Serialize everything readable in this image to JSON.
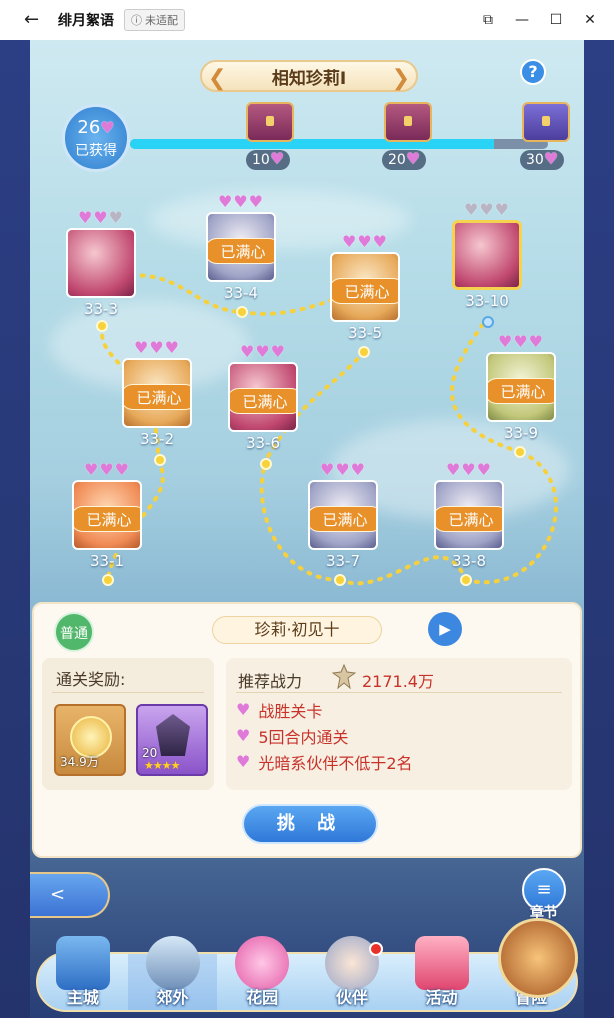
{
  "window": {
    "title": "绯月絮语",
    "badge": "未适配",
    "back_icon": "←",
    "minimize": "—",
    "maximize": "☐",
    "close": "✕",
    "pin": "⧉"
  },
  "header": {
    "chapter_title": "相知珍莉Ⅰ",
    "prev_icon": "chevron-left-icon",
    "next_icon": "chevron-right-icon",
    "help": "?"
  },
  "progress": {
    "earned_count": "26",
    "earned_label": "已获得",
    "fill_fraction": 0.87,
    "tiers": [
      {
        "value": "10"
      },
      {
        "value": "20"
      },
      {
        "value": "30"
      }
    ]
  },
  "stages": [
    {
      "id": "33-1",
      "label": "33-1",
      "status": "已满心",
      "hearts": 3,
      "max": 3
    },
    {
      "id": "33-2",
      "label": "33-2",
      "status": "已满心",
      "hearts": 3,
      "max": 3
    },
    {
      "id": "33-3",
      "label": "33-3",
      "status": "",
      "hearts": 2,
      "max": 3
    },
    {
      "id": "33-4",
      "label": "33-4",
      "status": "已满心",
      "hearts": 3,
      "max": 3
    },
    {
      "id": "33-5",
      "label": "33-5",
      "status": "已满心",
      "hearts": 3,
      "max": 3
    },
    {
      "id": "33-6",
      "label": "33-6",
      "status": "已满心",
      "hearts": 3,
      "max": 3
    },
    {
      "id": "33-7",
      "label": "33-7",
      "status": "已满心",
      "hearts": 3,
      "max": 3
    },
    {
      "id": "33-8",
      "label": "33-8",
      "status": "已满心",
      "hearts": 3,
      "max": 3
    },
    {
      "id": "33-9",
      "label": "33-9",
      "status": "已满心",
      "hearts": 3,
      "max": 3
    },
    {
      "id": "33-10",
      "label": "33-10",
      "status": "",
      "hearts": 0,
      "max": 3
    }
  ],
  "panel": {
    "mode": "普通",
    "stage_name": "珍莉·初见十",
    "video_icon": "video-camera-icon",
    "reward_title": "通关奖励:",
    "rewards": [
      {
        "name": "coin",
        "qty": "34.9万"
      },
      {
        "name": "crystal",
        "qty": "20",
        "stars": "★★★★"
      }
    ],
    "recommend_label": "推荐战力",
    "recommend_value": "2171.4万",
    "conditions": [
      "战胜关卡",
      "5回合内通关",
      "光暗系伙伴不低于2名"
    ],
    "challenge": "挑 战"
  },
  "side": {
    "back_tab": "<",
    "chapter_icon": "≡",
    "chapter_label": "章节"
  },
  "nav": [
    {
      "key": "main",
      "label": "主城",
      "active": false
    },
    {
      "key": "outskirts",
      "label": "郊外",
      "active": true
    },
    {
      "key": "garden",
      "label": "花园",
      "active": false
    },
    {
      "key": "partner",
      "label": "伙伴",
      "active": false,
      "notify": true
    },
    {
      "key": "event",
      "label": "活动",
      "active": false
    },
    {
      "key": "adventure",
      "label": "冒险",
      "active": false
    }
  ],
  "colors": {
    "accent_orange": "#e8912a",
    "heart": "#e07ad9",
    "progress": "#29d3f5",
    "red_text": "#c8322b"
  }
}
